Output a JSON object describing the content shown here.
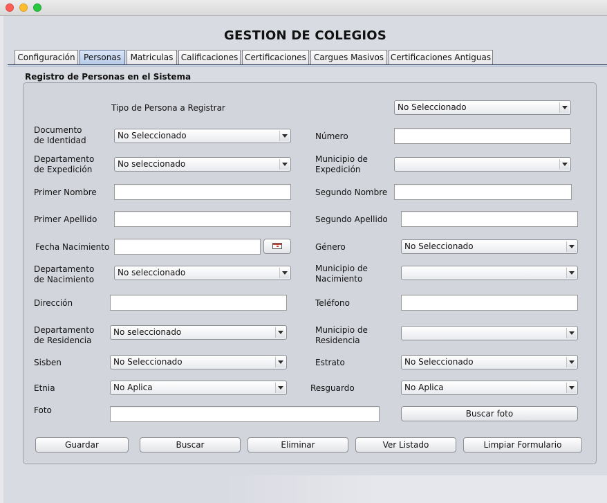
{
  "window": {
    "title": "GESTION DE COLEGIOS"
  },
  "tabs": [
    "Configuración",
    "Personas",
    "Matriculas",
    "Calificaciones",
    "Certificaciones",
    "Cargues Masivos",
    "Certificaciones Antiguas"
  ],
  "active_tab": "Personas",
  "panel": {
    "title": "Registro de Personas en el Sistema"
  },
  "form": {
    "tipo_persona": {
      "label": "Tipo de Persona a Registrar",
      "value": "No Seleccionado"
    },
    "documento": {
      "label_1": "Documento",
      "label_2": "de Identidad",
      "value": "No Seleccionado"
    },
    "numero": {
      "label": "Número",
      "value": ""
    },
    "depto_expedicion": {
      "label_1": "Departamento",
      "label_2": "de Expedición",
      "value": "No seleccionado"
    },
    "municipio_expedicion": {
      "label_1": "Municipio de",
      "label_2": "Expedición",
      "value": ""
    },
    "primer_nombre": {
      "label": "Primer Nombre",
      "value": ""
    },
    "segundo_nombre": {
      "label": "Segundo Nombre",
      "value": ""
    },
    "primer_apellido": {
      "label": "Primer Apellido",
      "value": ""
    },
    "segundo_apellido": {
      "label": "Segundo Apellido",
      "value": ""
    },
    "fecha_nacimiento": {
      "label": "Fecha Nacimiento",
      "value": "",
      "icon": "calendar-icon"
    },
    "genero": {
      "label": "Género",
      "value": "No Seleccionado"
    },
    "depto_nacimiento": {
      "label_1": "Departamento",
      "label_2": "de Nacimiento",
      "value": "No seleccionado"
    },
    "municipio_nacimiento": {
      "label_1": "Municipio de",
      "label_2": "Nacimiento",
      "value": ""
    },
    "direccion": {
      "label": "Dirección",
      "value": ""
    },
    "telefono": {
      "label": "Teléfono",
      "value": ""
    },
    "depto_residencia": {
      "label_1": "Departamento",
      "label_2": "de Residencia",
      "value": "No seleccionado"
    },
    "municipio_residencia": {
      "label_1": "Municipio de",
      "label_2": "Residencia",
      "value": ""
    },
    "sisben": {
      "label": "Sisben",
      "value": "No Seleccionado"
    },
    "estrato": {
      "label": "Estrato",
      "value": "No Seleccionado"
    },
    "etnia": {
      "label": "Etnia",
      "value": "No Aplica"
    },
    "resguardo": {
      "label": "Resguardo",
      "value": "No Aplica"
    },
    "foto": {
      "label": "Foto",
      "value": "",
      "button": "Buscar foto"
    }
  },
  "actions": {
    "guardar": "Guardar",
    "buscar": "Buscar",
    "eliminar": "Eliminar",
    "ver_listado": "Ver Listado",
    "limpiar": "Limpiar Formulario"
  }
}
